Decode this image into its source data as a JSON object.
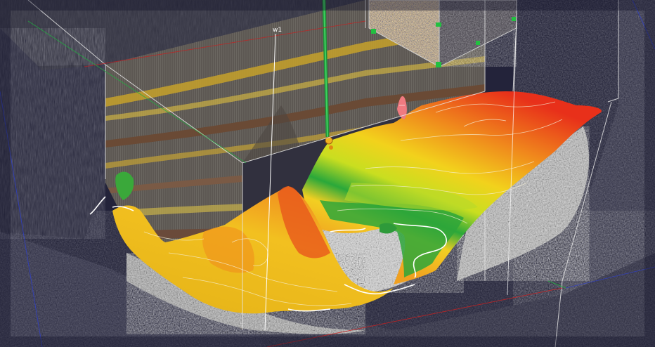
{
  "scene": {
    "well_label": "w1"
  },
  "colors": {
    "background": "#2a2a3a",
    "surface_high": "#e8301a",
    "surface_mid": "#f2d21c",
    "surface_low": "#2aa83a",
    "well_path": "#2fbf4a",
    "box_edge": "#e6e6e6",
    "axis_red": "#d02020",
    "axis_green": "#20b040",
    "axis_blue": "#3040d0"
  }
}
